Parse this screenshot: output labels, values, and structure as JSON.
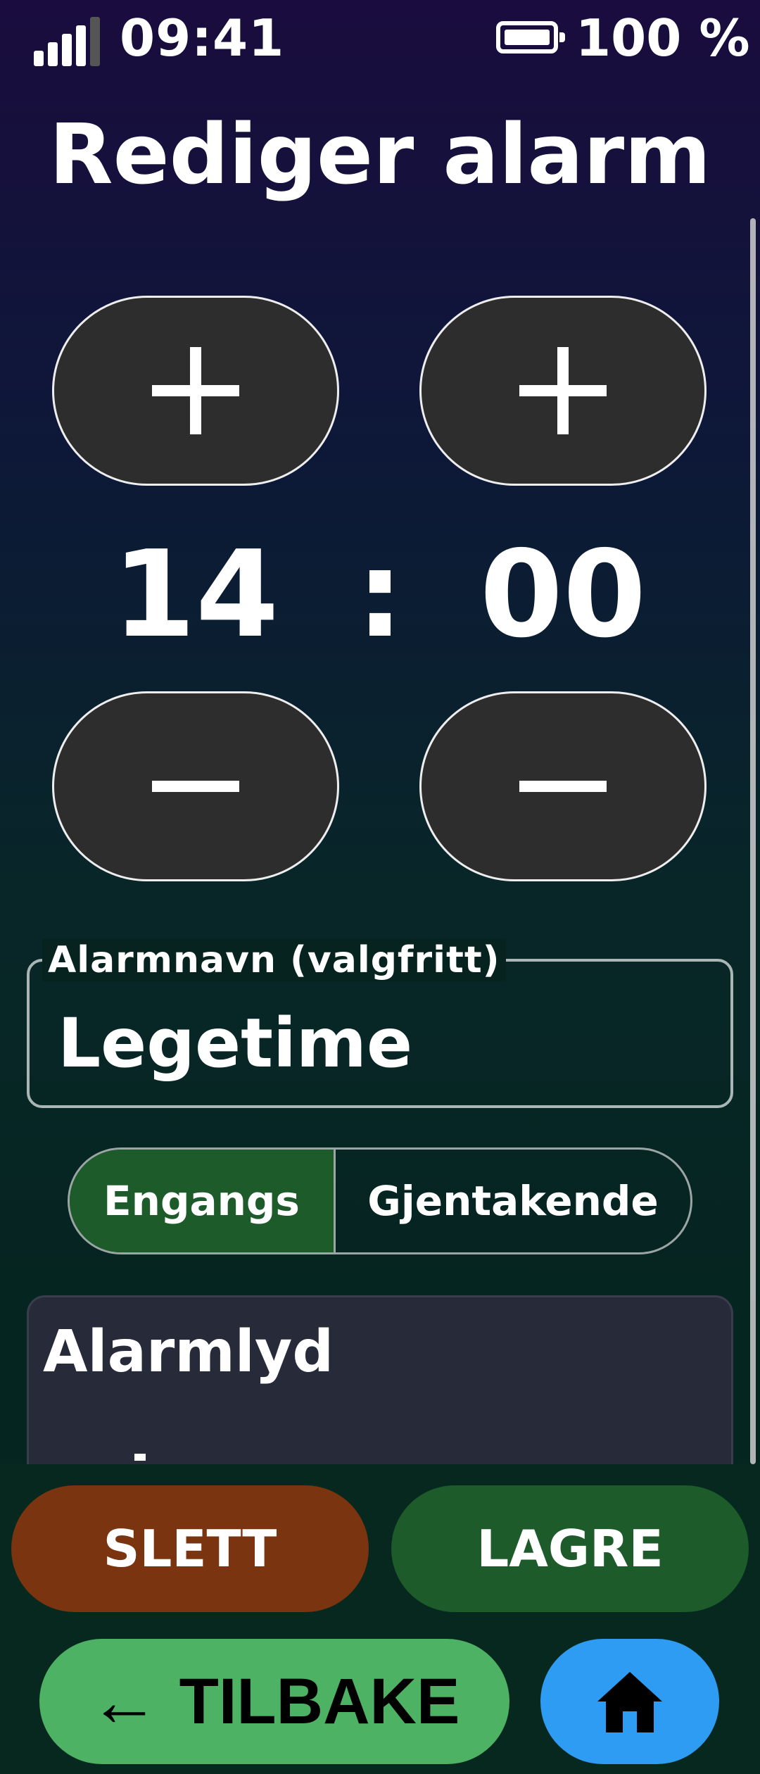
{
  "status_bar": {
    "time": "09:41",
    "battery": "100 %"
  },
  "page": {
    "title": "Rediger alarm"
  },
  "time_picker": {
    "hours": "14",
    "separator": ":",
    "minutes": "00"
  },
  "name_field": {
    "label": "Alarmnavn (valgfritt)",
    "value": "Legetime"
  },
  "repeat_toggle": {
    "options": [
      "Engangs",
      "Gjentakende"
    ],
    "selected": "Engangs"
  },
  "sound_section": {
    "title": "Alarmlyd"
  },
  "actions": {
    "delete": "SLETT",
    "save": "LAGRE",
    "back": "TILBAKE",
    "back_arrow": "←"
  },
  "colors": {
    "delete": "#7a3510",
    "save": "#1d5b2a",
    "back": "#4db264",
    "home": "#2e9cf2",
    "selected_segment": "#1e5b2b"
  },
  "icons": {
    "back": "arrow-left-icon",
    "home": "home-icon",
    "increment": "plus-icon",
    "decrement": "minus-icon"
  }
}
